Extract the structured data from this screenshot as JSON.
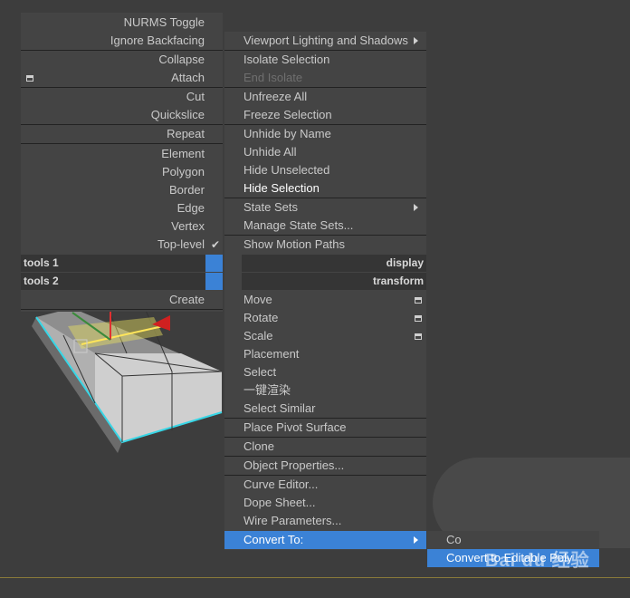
{
  "left_menu": {
    "items": [
      {
        "label": "NURMS Toggle"
      },
      {
        "label": "Ignore Backfacing"
      },
      {
        "label": "Collapse"
      },
      {
        "label": "Attach"
      },
      {
        "label": "Cut"
      },
      {
        "label": "Quickslice"
      },
      {
        "label": "Repeat"
      },
      {
        "label": "Element"
      },
      {
        "label": "Polygon"
      },
      {
        "label": "Border"
      },
      {
        "label": "Edge"
      },
      {
        "label": "Vertex"
      },
      {
        "label": "Top-level"
      },
      {
        "label": "Create"
      }
    ],
    "tools1": "tools 1",
    "tools2": "tools 2"
  },
  "right_menu": {
    "display_title": "display",
    "transform_title": "transform",
    "items": [
      {
        "label": "Viewport Lighting and Shadows"
      },
      {
        "label": "Isolate Selection"
      },
      {
        "label": "End Isolate"
      },
      {
        "label": "Unfreeze All"
      },
      {
        "label": "Freeze Selection"
      },
      {
        "label": "Unhide by Name"
      },
      {
        "label": "Unhide All"
      },
      {
        "label": "Hide Unselected"
      },
      {
        "label": "Hide Selection"
      },
      {
        "label": "State Sets"
      },
      {
        "label": "Manage State Sets..."
      },
      {
        "label": "Show Motion Paths"
      },
      {
        "label": "Move"
      },
      {
        "label": "Rotate"
      },
      {
        "label": "Scale"
      },
      {
        "label": "Placement"
      },
      {
        "label": "Select"
      },
      {
        "label": "一键渲染"
      },
      {
        "label": "Select Similar"
      },
      {
        "label": "Place Pivot Surface"
      },
      {
        "label": "Clone"
      },
      {
        "label": "Object Properties..."
      },
      {
        "label": "Curve Editor..."
      },
      {
        "label": "Dope Sheet..."
      },
      {
        "label": "Wire Parameters..."
      },
      {
        "label": "Convert To:"
      }
    ]
  },
  "submenu": {
    "items": [
      {
        "label": "Co"
      },
      {
        "label": "Convert to Editable Poly"
      }
    ]
  },
  "watermark": "Bai du 经验",
  "colors": {
    "highlight": "#3b82d6",
    "panel": "#444444",
    "background": "#3d3d3d"
  }
}
